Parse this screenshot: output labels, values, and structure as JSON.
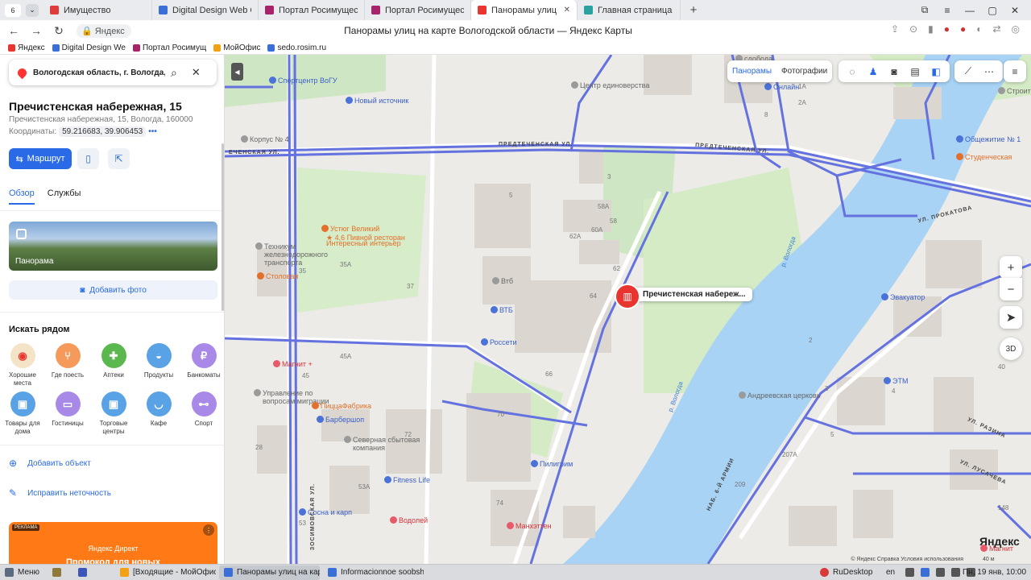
{
  "browser": {
    "tab_count": "6",
    "tabs": [
      {
        "label": "Имущество",
        "fav": "#e03b3b",
        "favtext": "РТС"
      },
      {
        "label": "Digital Design Web Client",
        "fav": "#3b6fd8"
      },
      {
        "label": "Портал Росимущества",
        "fav": "#a8246a"
      },
      {
        "label": "Портал Росимущества",
        "fav": "#a8246a"
      },
      {
        "label": "Панорамы улиц на карте",
        "fav": "#e8352f",
        "active": true
      },
      {
        "label": "Главная страница",
        "fav": "#2aa3a0"
      }
    ],
    "domain": "Яндекс",
    "page_title": "Панорамы улиц на карте Вологодской области — Яндекс Карты",
    "bookmarks": [
      {
        "label": "Яндекс",
        "color": "#e8352f"
      },
      {
        "label": "Digital Design We",
        "color": "#3b6fd8"
      },
      {
        "label": "Портал Росимущ",
        "color": "#a8246a"
      },
      {
        "label": "МойОфис",
        "color": "#f2a114"
      },
      {
        "label": "sedo.rosim.ru",
        "color": "#3b6fd8"
      }
    ]
  },
  "panel": {
    "search_value": "Вологодская область, г. Вологда, наб",
    "place_name": "Пречистенская набережная, 15",
    "place_address": "Пречистенская набережная, 15, Вологда, 160000",
    "coords_label": "Координаты:",
    "coords_value": "59.216683, 39.906453",
    "route_label": "Маршрут",
    "tab_overview": "Обзор",
    "tab_services": "Службы",
    "panorama_label": "Панорама",
    "add_photo": "Добавить фото",
    "nearby_title": "Искать рядом",
    "categories": [
      {
        "label": "Хорошие места",
        "color": "#f5e3c8",
        "glyph": "◉"
      },
      {
        "label": "Где поесть",
        "color": "#f59a5a",
        "glyph": "⑂"
      },
      {
        "label": "Аптеки",
        "color": "#5bb84f",
        "glyph": "✚"
      },
      {
        "label": "Продукты",
        "color": "#5aa2e6",
        "glyph": "◒"
      },
      {
        "label": "Банкоматы",
        "color": "#a889e8",
        "glyph": "₽"
      },
      {
        "label": "Товары для дома",
        "color": "#5aa2e6",
        "glyph": "▣"
      },
      {
        "label": "Гостиницы",
        "color": "#a889e8",
        "glyph": "▭"
      },
      {
        "label": "Торговые центры",
        "color": "#5aa2e6",
        "glyph": "▣"
      },
      {
        "label": "Кафе",
        "color": "#5aa2e6",
        "glyph": "◡"
      },
      {
        "label": "Спорт",
        "color": "#a889e8",
        "glyph": "⊷"
      }
    ],
    "add_object": "Добавить объект",
    "fix_error": "Исправить неточность",
    "ad_tag": "РЕКЛАМА",
    "ad_brand": "Яндекс Директ",
    "ad_promo": "Промокод для новых"
  },
  "map": {
    "toolbar_panoramas": "Панорамы",
    "toolbar_photos": "Фотографии",
    "popup_title": "Пречистенская набереж...",
    "pois": [
      {
        "id": "sport-center",
        "text": "Спортцентр ВоГУ",
        "kind": "blue"
      },
      {
        "id": "new-source",
        "text": "Новый источник",
        "kind": "blue"
      },
      {
        "id": "center-edinoverie",
        "text": "Центр единоверства",
        "kind": "gray"
      },
      {
        "id": "online",
        "text": "Онлайн",
        "kind": "blue"
      },
      {
        "id": "ustyug",
        "text": "Устюг Великий",
        "kind": "orange"
      },
      {
        "id": "ustyug-sub",
        "text": "★ 4,6 Пивной ресторан",
        "kind": "orange"
      },
      {
        "id": "ustyug-sub2",
        "text": "Интересный интерьер",
        "kind": "orange"
      },
      {
        "id": "tech-school",
        "text": "Техникум железнодорожного транспорта",
        "kind": "gray"
      },
      {
        "id": "stolovaya",
        "text": "Столовая",
        "kind": "orange"
      },
      {
        "id": "vtb1",
        "text": "Втб",
        "kind": "gray"
      },
      {
        "id": "vtb2",
        "text": "ВТБ",
        "kind": "blue"
      },
      {
        "id": "rosseti",
        "text": "Россети",
        "kind": "blue"
      },
      {
        "id": "magnit",
        "text": "Магнит +",
        "kind": "red"
      },
      {
        "id": "management",
        "text": "Управление по вопросам миграции",
        "kind": "gray"
      },
      {
        "id": "pizza",
        "text": "ПиццаФабрика",
        "kind": "orange"
      },
      {
        "id": "barber",
        "text": "Барбершоп",
        "kind": "blue"
      },
      {
        "id": "northern-company",
        "text": "Северная сбытовая компания",
        "kind": "gray"
      },
      {
        "id": "fitness",
        "text": "Fitness Life",
        "kind": "blue"
      },
      {
        "id": "piligrim",
        "text": "Пилигрим",
        "kind": "blue"
      },
      {
        "id": "vodoley",
        "text": "Водолей",
        "kind": "red"
      },
      {
        "id": "manhattan",
        "text": "Манхэттен",
        "kind": "red"
      },
      {
        "id": "sosna",
        "text": "Сосна и карп",
        "kind": "blue"
      },
      {
        "id": "evakuator",
        "text": "Эвакуатор",
        "kind": "blue"
      },
      {
        "id": "etm",
        "text": "ЭТМ",
        "kind": "blue"
      },
      {
        "id": "church",
        "text": "Андреевская церковь",
        "kind": "gray"
      },
      {
        "id": "dorm",
        "text": "Общежитие № 1",
        "kind": "blue"
      },
      {
        "id": "student",
        "text": "Студенческая",
        "kind": "orange"
      },
      {
        "id": "sloboda",
        "text": "слобода",
        "kind": "gray"
      },
      {
        "id": "stroitel",
        "text": "Строител колледж",
        "kind": "gray"
      },
      {
        "id": "korpus4",
        "text": "Корпус № 4",
        "kind": "gray"
      },
      {
        "id": "magnit2",
        "text": "Магнит",
        "kind": "red"
      }
    ],
    "streets": [
      {
        "id": "predtechenskaya-1",
        "text": "ПРЕДТЕЧЕНСКАЯ УЛ."
      },
      {
        "id": "predtechenskaya-2",
        "text": "ПРЕДТЕЧЕНСКАЯ УЛ."
      },
      {
        "id": "predtechenskaya-west",
        "text": "ЕЧЕНСКАЯ УЛ."
      },
      {
        "id": "prokatova",
        "text": "УЛ. ПРОКАТОВА"
      },
      {
        "id": "zosimovskaya",
        "text": "ЗОСИМОВСКАЯ УЛ."
      },
      {
        "id": "razina",
        "text": "УЛ. РАЗИНА"
      },
      {
        "id": "lusacheva",
        "text": "УЛ. ЛУСАЧЕВА"
      },
      {
        "id": "naberezhnaya-6a",
        "text": "НАБ. 6-Й АРМИИ"
      }
    ],
    "river_labels": [
      "р. Вологда",
      "р. Вологда"
    ],
    "house_numbers": [
      "3",
      "5",
      "58А",
      "58",
      "60А",
      "62А",
      "62",
      "64",
      "66",
      "70",
      "72",
      "74",
      "37",
      "35А",
      "35",
      "45А",
      "45",
      "28",
      "53А",
      "53",
      "58",
      "2",
      "3",
      "4",
      "5",
      "207А",
      "209",
      "148",
      "2А",
      "1А",
      "8",
      "40"
    ],
    "copyright": "© Яндекс   Справка   Условия использования",
    "scale": "40 м",
    "logo": "Яндекс"
  },
  "taskbar": {
    "menu": "Меню",
    "tasks": [
      {
        "label": "[Входящие - МойОфис П...",
        "color": "#f2a114"
      },
      {
        "label": "Панорамы улиц на карте...",
        "color": "#3b6fd8",
        "active": true
      },
      {
        "label": "Informacionnoe soobshhe...",
        "color": "#3b6fd8"
      }
    ],
    "rudesktop": "RuDesktop",
    "lang": "en",
    "clock": "Пн, 19 янв, 10:00"
  }
}
